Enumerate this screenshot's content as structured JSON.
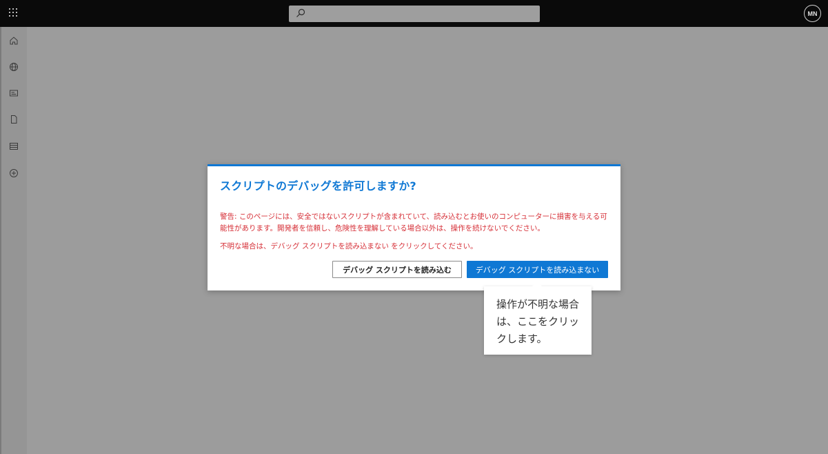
{
  "topbar": {
    "avatar_initials": "MN",
    "icons": [
      "waffle-icon",
      "search-icon"
    ]
  },
  "siderail": {
    "items": [
      {
        "icon": "home-icon"
      },
      {
        "icon": "globe-icon"
      },
      {
        "icon": "card-icon"
      },
      {
        "icon": "file-icon"
      },
      {
        "icon": "list-icon"
      },
      {
        "icon": "add-circle-icon"
      }
    ]
  },
  "dialog": {
    "title": "スクリプトのデバッグを許可しますか?",
    "warning": "警告: このページには、安全ではないスクリプトが含まれていて、読み込むとお使いのコンピューターに損害を与える可能性があります。開発者を信頼し、危険性を理解している場合以外は、操作を続けないでください。",
    "note": "不明な場合は、デバッグ スクリプトを読み込まない をクリックしてください。",
    "load_button": "デバッグ スクリプトを読み込む",
    "dont_load_button": "デバッグ スクリプトを読み込まない"
  },
  "callout": {
    "text": "操作が不明な場合は、ここをクリックします。"
  },
  "colors": {
    "accent": "#0f78d4",
    "warning": "#d62f37",
    "topbar": "#0a0a0a",
    "backdrop": "#9c9c9c"
  }
}
